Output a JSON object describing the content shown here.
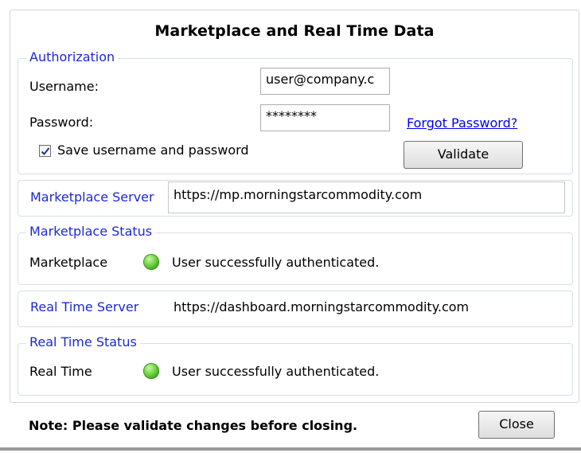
{
  "dialog": {
    "title": "Marketplace and Real Time Data",
    "note": "Note: Please validate changes before closing.",
    "close_label": "Close"
  },
  "authorization": {
    "legend": "Authorization",
    "username_label": "Username:",
    "username_value": "user@company.c",
    "password_label": "Password:",
    "password_value": "********",
    "forgot_link": "Forgot Password?",
    "save_label": "Save username and password",
    "save_checked": true,
    "validate_label": "Validate"
  },
  "marketplace_server": {
    "label": "Marketplace Server",
    "value": "https://mp.morningstarcommodity.com"
  },
  "marketplace_status": {
    "legend": "Marketplace Status",
    "label": "Marketplace",
    "status_text": "User successfully authenticated.",
    "status_color": "#4cbb24"
  },
  "realtime_server": {
    "label": "Real Time Server",
    "value": "https://dashboard.morningstarcommodity.com"
  },
  "realtime_status": {
    "legend": "Real Time Status",
    "label": "Real Time",
    "status_text": "User successfully authenticated.",
    "status_color": "#4cbb24"
  },
  "colors": {
    "legend": "#1c29d4",
    "link": "#0000ee"
  }
}
